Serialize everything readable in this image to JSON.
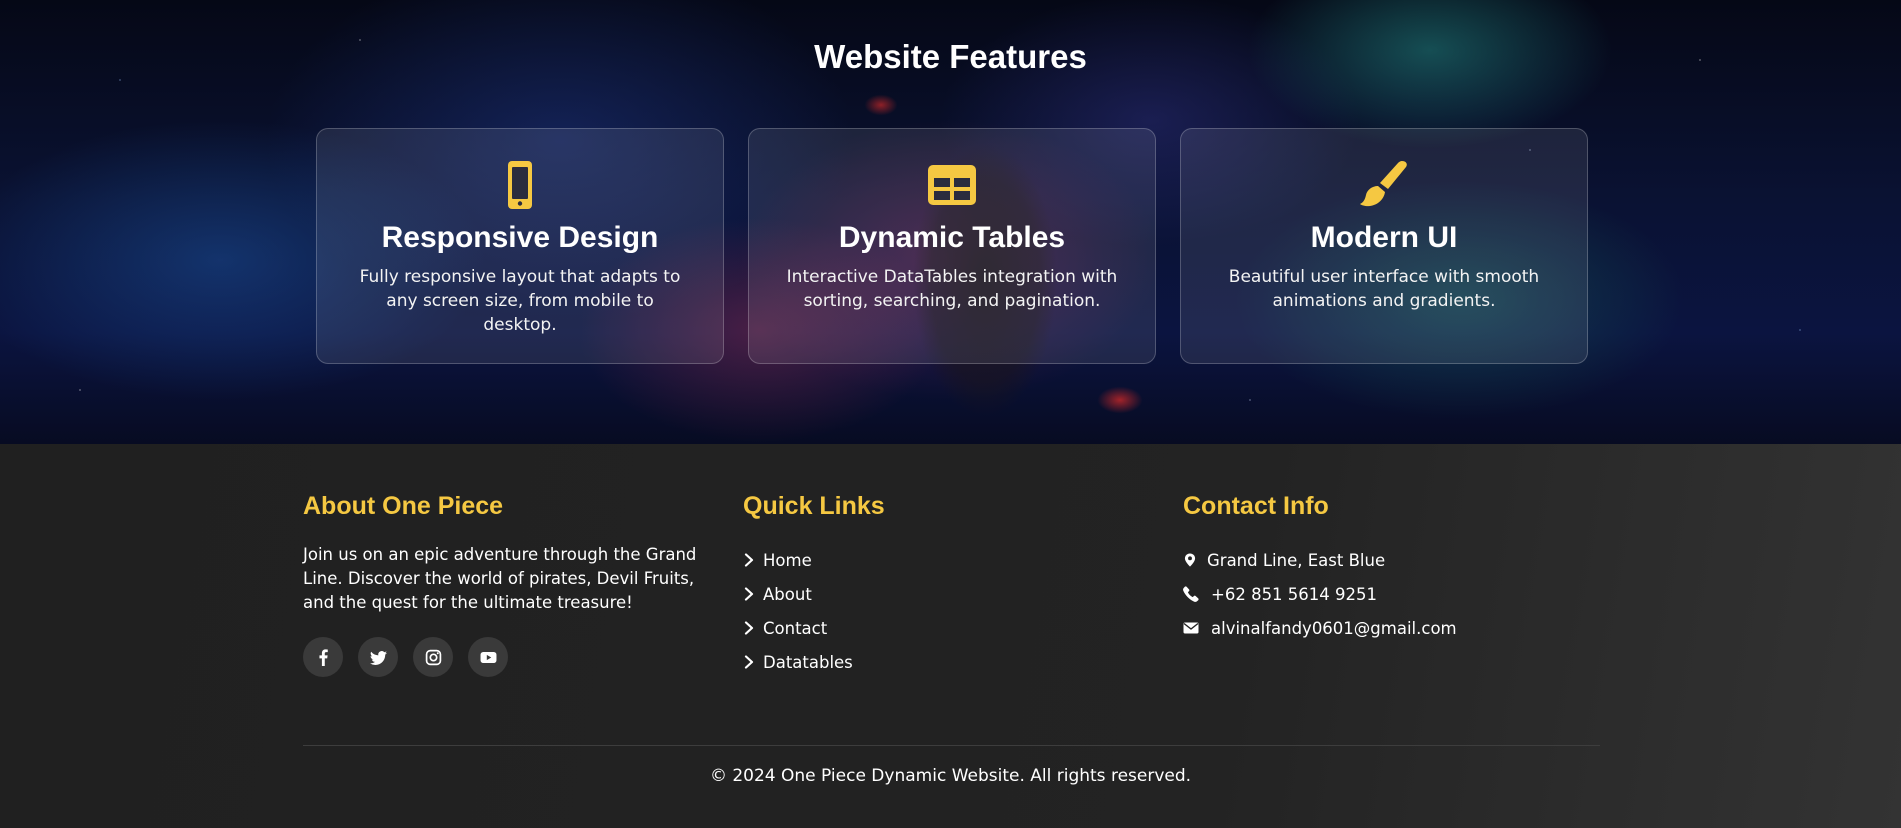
{
  "features": {
    "title": "Website Features",
    "cards": [
      {
        "icon": "mobile-phone-icon",
        "title": "Responsive Design",
        "description": "Fully responsive layout that adapts to any screen size, from mobile to desktop."
      },
      {
        "icon": "table-icon",
        "title": "Dynamic Tables",
        "description": "Interactive DataTables integration with sorting, searching, and pagination."
      },
      {
        "icon": "paint-brush-icon",
        "title": "Modern UI",
        "description": "Beautiful user interface with smooth animations and gradients."
      }
    ]
  },
  "footer": {
    "about": {
      "heading": "About One Piece",
      "text": "Join us on an epic adventure through the Grand Line. Discover the world of pirates, Devil Fruits, and the quest for the ultimate treasure!",
      "socials": [
        "facebook-icon",
        "twitter-icon",
        "instagram-icon",
        "youtube-icon"
      ]
    },
    "quick_links": {
      "heading": "Quick Links",
      "items": [
        "Home",
        "About",
        "Contact",
        "Datatables"
      ]
    },
    "contact": {
      "heading": "Contact Info",
      "address": "Grand Line, East Blue",
      "phone": "+62 851 5614 9251",
      "email": "alvinalfandy0601@gmail.com"
    },
    "copyright": "© 2024 One Piece Dynamic Website. All rights reserved."
  },
  "colors": {
    "accent": "#f5c842",
    "footer_bg": "#232323",
    "card_bg": "rgba(255,255,255,0.09)"
  }
}
